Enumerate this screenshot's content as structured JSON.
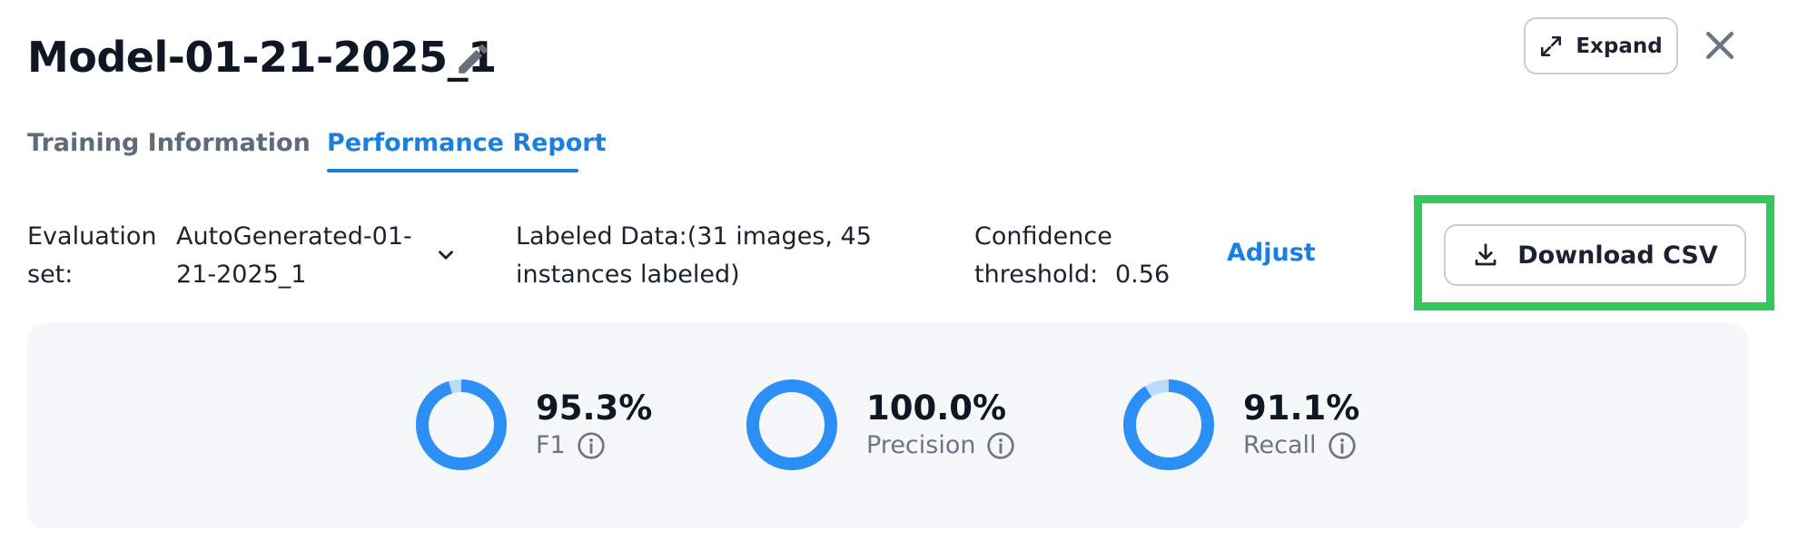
{
  "header": {
    "title": "Model-01-21-2025_1",
    "expand_label": "Expand"
  },
  "tabs": [
    {
      "label": "Training Information",
      "active": false
    },
    {
      "label": "Performance Report",
      "active": true
    }
  ],
  "controls": {
    "evaluation_label": "Evaluation set:",
    "evaluation_value": "AutoGenerated-01-21-2025_1",
    "labeled_data": "Labeled Data:(31 images, 45 instances labeled)",
    "confidence_label": "Confidence threshold:",
    "confidence_value": "0.56",
    "adjust_label": "Adjust",
    "download_label": "Download CSV"
  },
  "metrics": [
    {
      "name": "F1",
      "value": "95.3%",
      "fraction": 0.953
    },
    {
      "name": "Precision",
      "value": "100.0%",
      "fraction": 1.0
    },
    {
      "name": "Recall",
      "value": "91.1%",
      "fraction": 0.911
    }
  ],
  "colors": {
    "accent": "#1b7fe0",
    "donut_fill": "#2b8ff5",
    "donut_track": "#b9dcfb",
    "highlight": "#34c759"
  }
}
